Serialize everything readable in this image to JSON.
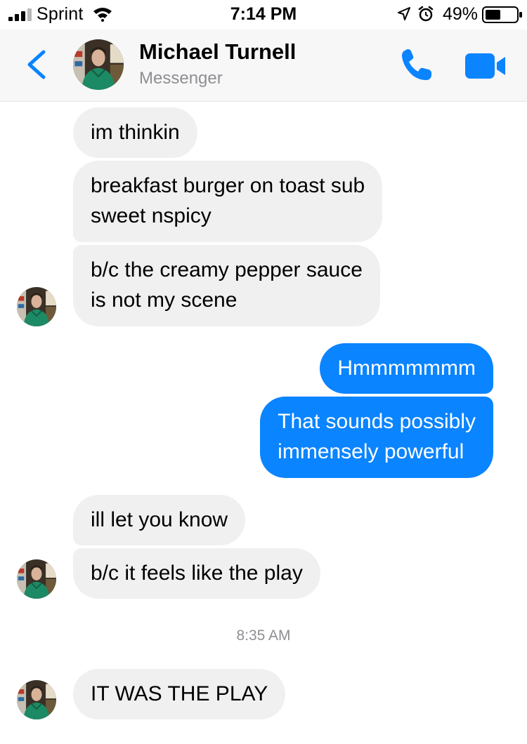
{
  "status_bar": {
    "carrier": "Sprint",
    "time": "7:14 PM",
    "battery": "49%"
  },
  "header": {
    "contact_name": "Michael Turnell",
    "subtitle": "Messenger"
  },
  "messages": [
    {
      "from": "them",
      "text": "im thinkin"
    },
    {
      "from": "them",
      "lines": [
        "breakfast burger on toast sub",
        "sweet nspicy"
      ]
    },
    {
      "from": "them",
      "lines": [
        "b/c the creamy pepper sauce",
        "is not my scene"
      ]
    },
    {
      "from": "me",
      "text": "Hmmmmmmm"
    },
    {
      "from": "me",
      "lines": [
        "That sounds possibly",
        "immensely powerful"
      ]
    },
    {
      "from": "them",
      "text": "ill let you know"
    },
    {
      "from": "them",
      "text": "b/c it feels like the play"
    },
    {
      "from": "them",
      "text": "IT WAS THE PLAY"
    }
  ],
  "timestamp": "8:35 AM",
  "colors": {
    "accent": "#0a84ff",
    "incoming_bubble": "#f0f0f0",
    "header_bg": "#f7f7f8"
  }
}
